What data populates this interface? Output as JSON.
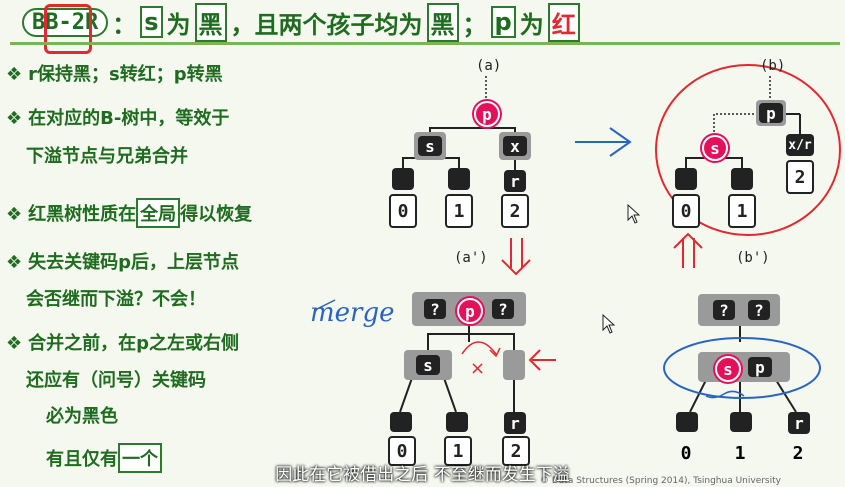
{
  "title": {
    "bb2r": "BB-2R",
    "colon": "：",
    "s": "s",
    "wei1": "为",
    "hei1": "黑",
    "mid": "，且两个孩子均为",
    "hei2": "黑",
    "semi": "；",
    "p": "p",
    "wei2": "为",
    "hong": "红"
  },
  "bullets": {
    "b1": "r保持黑；s转红；p转黑",
    "b2_line1": "在对应的B-树中，等效于",
    "b2_line2": "下溢节点与兄弟合并",
    "b3_pre": "红黑树性质在",
    "b3_box": "全局",
    "b3_post": "得以恢复",
    "b4_line1": "失去关键码p后，上层节点",
    "b4_line2": "会否继而下溢？不会！",
    "b5_line1": "合并之前，在p之左或右侧",
    "b5_line2": "还应有（问号）关键码",
    "b5_line3": "必为黑色",
    "b6_pre": "有且仅有",
    "b6_box": "一个"
  },
  "diagrams": {
    "a_label": "(a)",
    "b_label": "(b)",
    "a2_label": "(a')",
    "b2_label": "(b')",
    "p": "p",
    "s": "s",
    "x": "x",
    "r": "r",
    "xr": "x/r",
    "q": "?",
    "leaf0": "0",
    "leaf1": "1",
    "leaf2": "2",
    "cross": "×",
    "merge": "merge"
  },
  "subtitle": "因此在它被借出之后 不至继而发生下溢",
  "footer": "© Data Structures (Spring 2014), Tsinghua University"
}
